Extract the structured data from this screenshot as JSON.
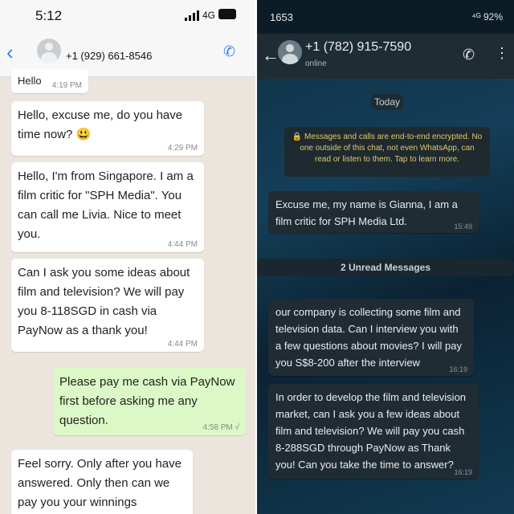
{
  "left": {
    "status": {
      "time": "5:12",
      "network": "4G"
    },
    "header": {
      "phone": "+1 (929) 661-8546"
    },
    "messages": [
      {
        "text": "Hello",
        "time": "4:19 PM"
      },
      {
        "text": "Hello, excuse me, do you have time now? 😃",
        "time": "4:29 PM"
      },
      {
        "text": "Hello, I'm from Singapore. I am a film critic for \"SPH Media\". You can call me Livia. Nice to meet you.",
        "time": "4:44 PM"
      },
      {
        "text": "Can I ask you some ideas about film and television? We will pay you 8-118SGD in cash via PayNow as a thank you!",
        "time": "4:44 PM"
      },
      {
        "text": "Please pay me cash via PayNow first before asking me any question.",
        "time": "4:58 PM √"
      },
      {
        "text": "Feel sorry. Only after you have answered. Only then can we pay you your winnings",
        "time": ""
      }
    ]
  },
  "right": {
    "status": {
      "time": "1653",
      "indicators": "⁴ᴳ 92%"
    },
    "header": {
      "phone": "+1 (782) 915-7590",
      "status": "online"
    },
    "date_chip": "Today",
    "notice": "🔒 Messages and calls are end-to-end encrypted. No one outside of this chat, not even WhatsApp, can read or listen to them. Tap to learn more.",
    "unread": "2 Unread Messages",
    "messages": [
      {
        "text": "Excuse me, my name is Gianna, I am a film critic for SPH Media Ltd.",
        "time": "15:49"
      },
      {
        "text": "our company is collecting some film and television data. Can I interview you with a few questions about movies? I will pay you S$8-200 after the interview",
        "time": "16:19"
      },
      {
        "text": "In order to develop the film and television market, can I ask you a few ideas about film and television? We will pay you cash 8-288SGD through PayNow as Thank you! Can you take the time to answer?",
        "time": "16:19"
      }
    ]
  },
  "colors": {
    "left_bg": "#ece5dd",
    "incoming": "#ffffff",
    "outgoing": "#dcf8c6",
    "ios_blue": "#2d7ff9",
    "dark_bubble": "#202c33",
    "dark_header": "#1f2c34"
  },
  "icons": [
    "back-arrow-icon",
    "add-call-icon",
    "call-icon",
    "more-options-icon",
    "signal-icon",
    "battery-icon",
    "lock-icon"
  ]
}
